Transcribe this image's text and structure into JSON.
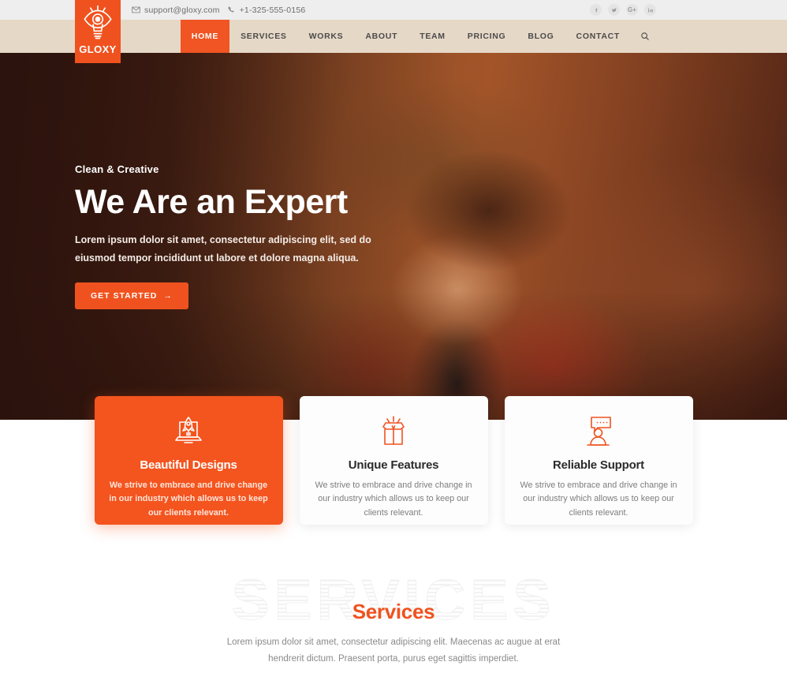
{
  "brand": {
    "name": "GLOXY",
    "logo_icon": "eye-in-lightbulb-icon",
    "accent_color": "#f0521f",
    "nav_background": "#e6d8c7",
    "topbar_background": "#eeeeee"
  },
  "topbar": {
    "email": "support@gloxy.com",
    "email_icon": "envelope-icon",
    "phone": "+1-325-555-0156",
    "phone_icon": "phone-icon",
    "social": [
      {
        "name": "facebook-icon",
        "label": "f"
      },
      {
        "name": "twitter-icon",
        "label": "t"
      },
      {
        "name": "google-plus-icon",
        "label": "G+"
      },
      {
        "name": "linkedin-icon",
        "label": "in"
      }
    ]
  },
  "nav": {
    "items": [
      {
        "label": "HOME",
        "active": true
      },
      {
        "label": "SERVICES",
        "active": false
      },
      {
        "label": "WORKS",
        "active": false
      },
      {
        "label": "ABOUT",
        "active": false
      },
      {
        "label": "TEAM",
        "active": false
      },
      {
        "label": "PRICING",
        "active": false
      },
      {
        "label": "BLOG",
        "active": false
      },
      {
        "label": "CONTACT",
        "active": false
      }
    ],
    "search_icon": "search-icon"
  },
  "hero": {
    "kicker": "Clean & Creative",
    "title": "We Are an Expert",
    "subtitle": "Lorem ipsum dolor sit amet, consectetur adipiscing elit, sed do eiusmod tempor incididunt ut labore et dolore magna aliqua.",
    "cta_label": "GET STARTED",
    "cta_arrow": "→",
    "background_image": "photo-woman-with-curly-hair-using-phone"
  },
  "features": [
    {
      "title": "Beautiful Designs",
      "text": "We strive to embrace and drive change in our industry which allows us to keep our clients relevant.",
      "icon": "rocket-laptop-icon",
      "featured": true
    },
    {
      "title": "Unique Features",
      "text": "We strive to embrace and drive change in our industry which allows us to keep our clients relevant.",
      "icon": "open-gift-box-icon",
      "featured": false
    },
    {
      "title": "Reliable Support",
      "text": "We strive to embrace and drive change in our industry which allows us to keep our clients relevant.",
      "icon": "support-person-chat-icon",
      "featured": false
    }
  ],
  "services": {
    "watermark": "SERVICES",
    "title": "Services",
    "subtitle": "Lorem ipsum dolor sit amet, consectetur adipiscing elit. Maecenas ac augue at erat hendrerit dictum. Praesent porta, purus eget sagittis imperdiet."
  }
}
